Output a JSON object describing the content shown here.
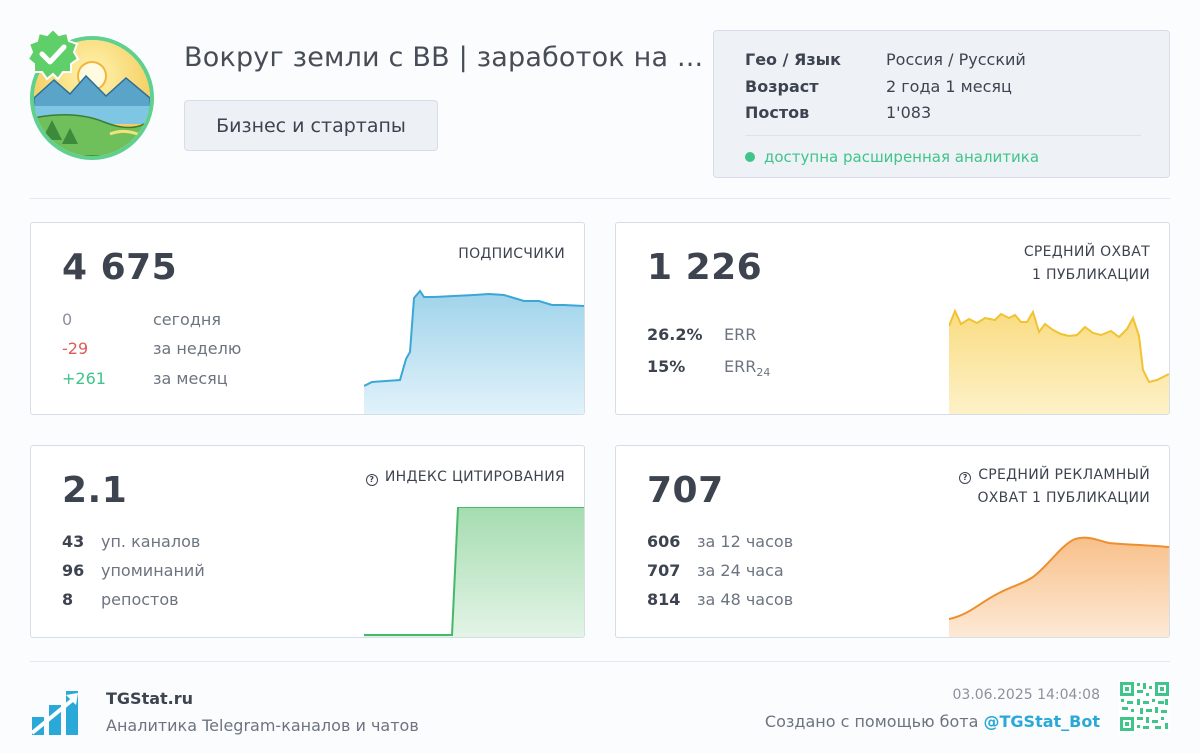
{
  "header": {
    "channel_title": "Вокруг земли с ВВ | заработок на ...",
    "category": "Бизнес и стартапы"
  },
  "info": {
    "geo_label": "Гео / Язык",
    "geo_value": "Россия / Русский",
    "age_label": "Возраст",
    "age_value": "2 года 1 месяц",
    "posts_label": "Постов",
    "posts_value": "1'083",
    "analytics_text": "доступна расширенная аналитика"
  },
  "cards": {
    "subscribers": {
      "title": "ПОДПИСЧИКИ",
      "value": "4 675",
      "rows": [
        {
          "num": "0",
          "label": "сегодня",
          "color": "#8b929c"
        },
        {
          "num": "-29",
          "label": "за неделю",
          "color": "#e05a5a"
        },
        {
          "num": "+261",
          "label": "за месяц",
          "color": "#3fc48a"
        }
      ]
    },
    "reach": {
      "title_line1": "СРЕДНИЙ ОХВАТ",
      "title_line2": "1 ПУБЛИКАЦИИ",
      "value": "1 226",
      "err_value": "26.2%",
      "err_label": "ERR",
      "err24_value": "15%",
      "err24_label": "ERR",
      "err24_sub": "24"
    },
    "citation": {
      "title": "ИНДЕКС ЦИТИРОВАНИЯ",
      "value": "2.1",
      "rows": [
        {
          "num": "43",
          "label": "уп. каналов"
        },
        {
          "num": "96",
          "label": "упоминаний"
        },
        {
          "num": "8",
          "label": "репостов"
        }
      ]
    },
    "ad_reach": {
      "title_line1": "СРЕДНИЙ РЕКЛАМНЫЙ",
      "title_line2": "ОХВАТ 1 ПУБЛИКАЦИИ",
      "value": "707",
      "rows": [
        {
          "num": "606",
          "label": "за 12 часов"
        },
        {
          "num": "707",
          "label": "за 24 часа"
        },
        {
          "num": "814",
          "label": "за 48 часов"
        }
      ]
    }
  },
  "footer": {
    "brand": "TGStat.ru",
    "tagline": "Аналитика Telegram-каналов и чатов",
    "timestamp": "03.06.2025 14:04:08",
    "created_text": "Создано с помощью бота",
    "bot_handle": "@TGStat_Bot"
  },
  "colors": {
    "accent_green": "#3fc48a",
    "negative_red": "#e05a5a",
    "subscribers_chart": "#3aa7d6",
    "reach_chart": "#f2c233",
    "citation_chart": "#46b86a",
    "ad_reach_chart": "#ee8f2d"
  },
  "icons": [
    "verified-badge-icon",
    "help-circle-icon",
    "tgstat-logo-icon",
    "qr-code-icon"
  ]
}
